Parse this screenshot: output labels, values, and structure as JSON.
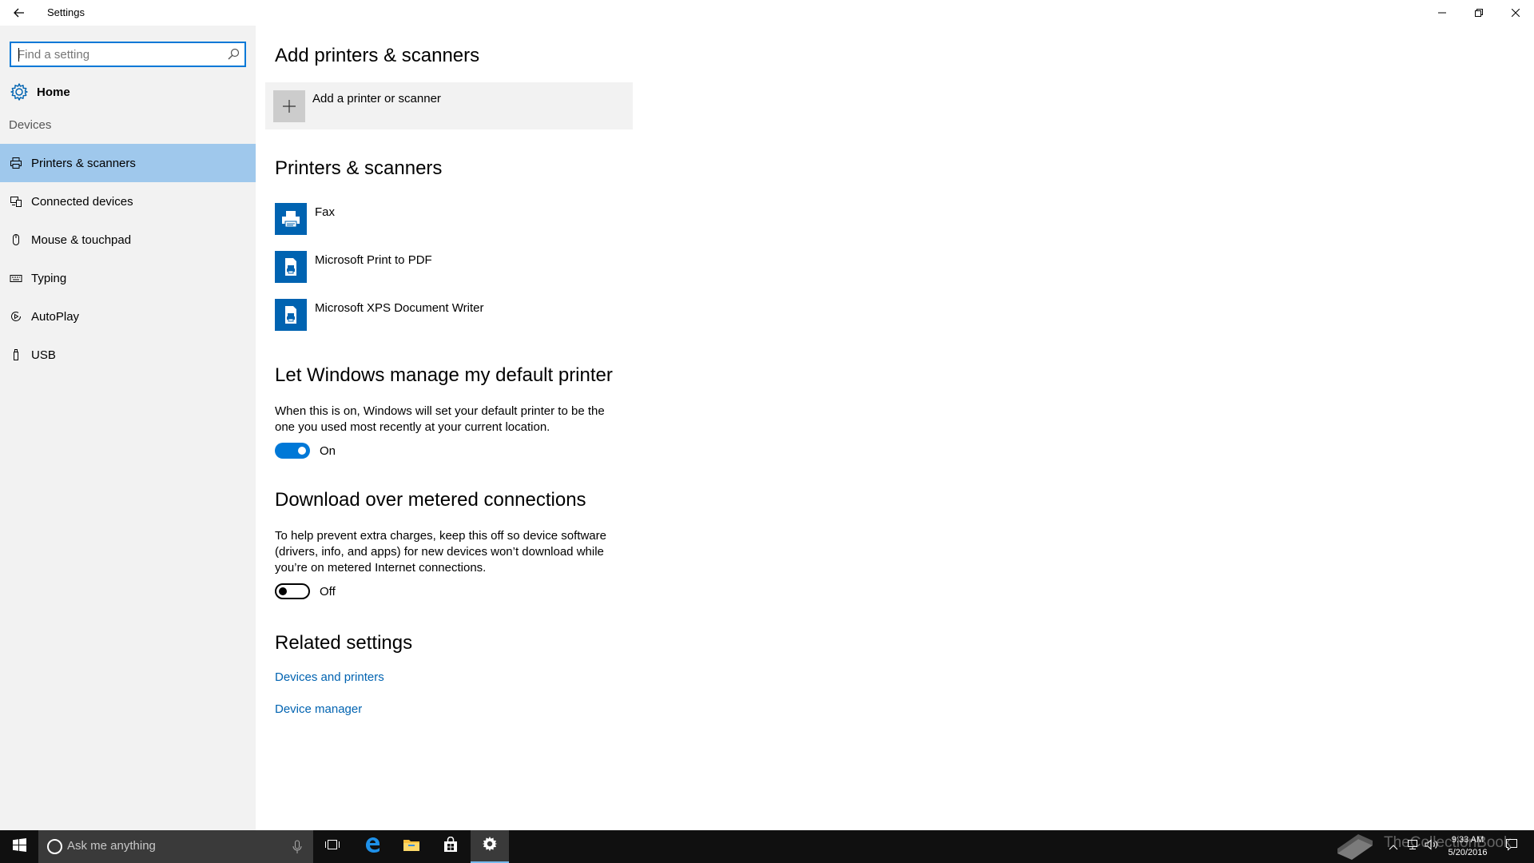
{
  "window": {
    "title": "Settings",
    "back_icon": "back-arrow-icon",
    "controls": [
      "minimize",
      "restore",
      "close"
    ]
  },
  "sidebar": {
    "search_placeholder": "Find a setting",
    "home_label": "Home",
    "section_label": "Devices",
    "items": [
      {
        "label": "Printers & scanners",
        "icon": "printer-icon",
        "active": true
      },
      {
        "label": "Connected devices",
        "icon": "connected-devices-icon",
        "active": false
      },
      {
        "label": "Mouse & touchpad",
        "icon": "mouse-icon",
        "active": false
      },
      {
        "label": "Typing",
        "icon": "keyboard-icon",
        "active": false
      },
      {
        "label": "AutoPlay",
        "icon": "autoplay-icon",
        "active": false
      },
      {
        "label": "USB",
        "icon": "usb-icon",
        "active": false
      }
    ]
  },
  "main": {
    "add_heading": "Add printers & scanners",
    "add_button_label": "Add a printer or scanner",
    "printers_heading": "Printers & scanners",
    "printers": [
      {
        "name": "Fax",
        "icon": "fax-icon"
      },
      {
        "name": "Microsoft Print to PDF",
        "icon": "pdf-printer-icon"
      },
      {
        "name": "Microsoft XPS Document Writer",
        "icon": "xps-printer-icon"
      }
    ],
    "default_printer": {
      "heading": "Let Windows manage my default printer",
      "description": "When this is on, Windows will set your default printer to be the one you used most recently at your current location.",
      "state_label": "On",
      "enabled": true
    },
    "metered": {
      "heading": "Download over metered connections",
      "description": "To help prevent extra charges, keep this off so device software (drivers, info, and apps) for new devices won’t download while you’re on metered Internet connections.",
      "state_label": "Off",
      "enabled": false
    },
    "related": {
      "heading": "Related settings",
      "links": [
        "Devices and printers",
        "Device manager"
      ]
    }
  },
  "taskbar": {
    "search_placeholder": "Ask me anything",
    "pinned": [
      "task-view",
      "edge",
      "file-explorer",
      "store",
      "settings"
    ],
    "time": "9:33 AM",
    "date": "5/20/2016",
    "watermark": "TheCollectionBook"
  },
  "colors": {
    "accent": "#0078d7",
    "active_nav": "#9fc8ec",
    "link": "#0063b1",
    "sidebar_bg": "#f2f2f2",
    "taskbar_bg": "#101010"
  }
}
